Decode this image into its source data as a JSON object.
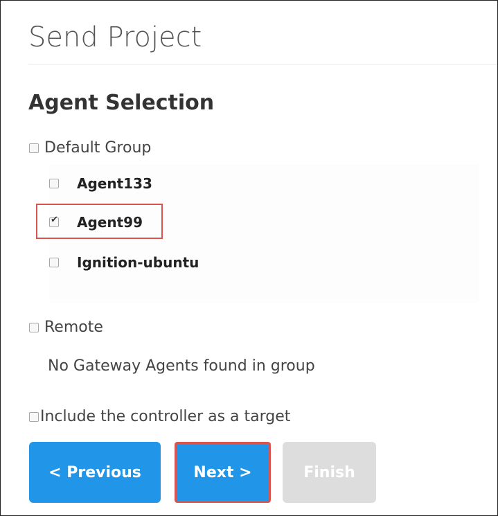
{
  "page": {
    "title": "Send Project",
    "section_title": "Agent Selection"
  },
  "groups": [
    {
      "label": "Default Group",
      "checked": false,
      "agents": [
        {
          "label": "Agent133",
          "checked": false
        },
        {
          "label": "Agent99",
          "checked": true
        },
        {
          "label": "Ignition-ubuntu",
          "checked": false
        }
      ]
    },
    {
      "label": "Remote",
      "checked": false,
      "empty_message": "No Gateway Agents found in group"
    }
  ],
  "include_controller": {
    "label": "Include the controller as a target",
    "checked": false
  },
  "buttons": {
    "previous": "< Previous",
    "next": "Next >",
    "finish": "Finish"
  },
  "colors": {
    "primary_button": "#2196e8",
    "disabled_button": "#dddddd",
    "highlight": "#d9534f"
  }
}
